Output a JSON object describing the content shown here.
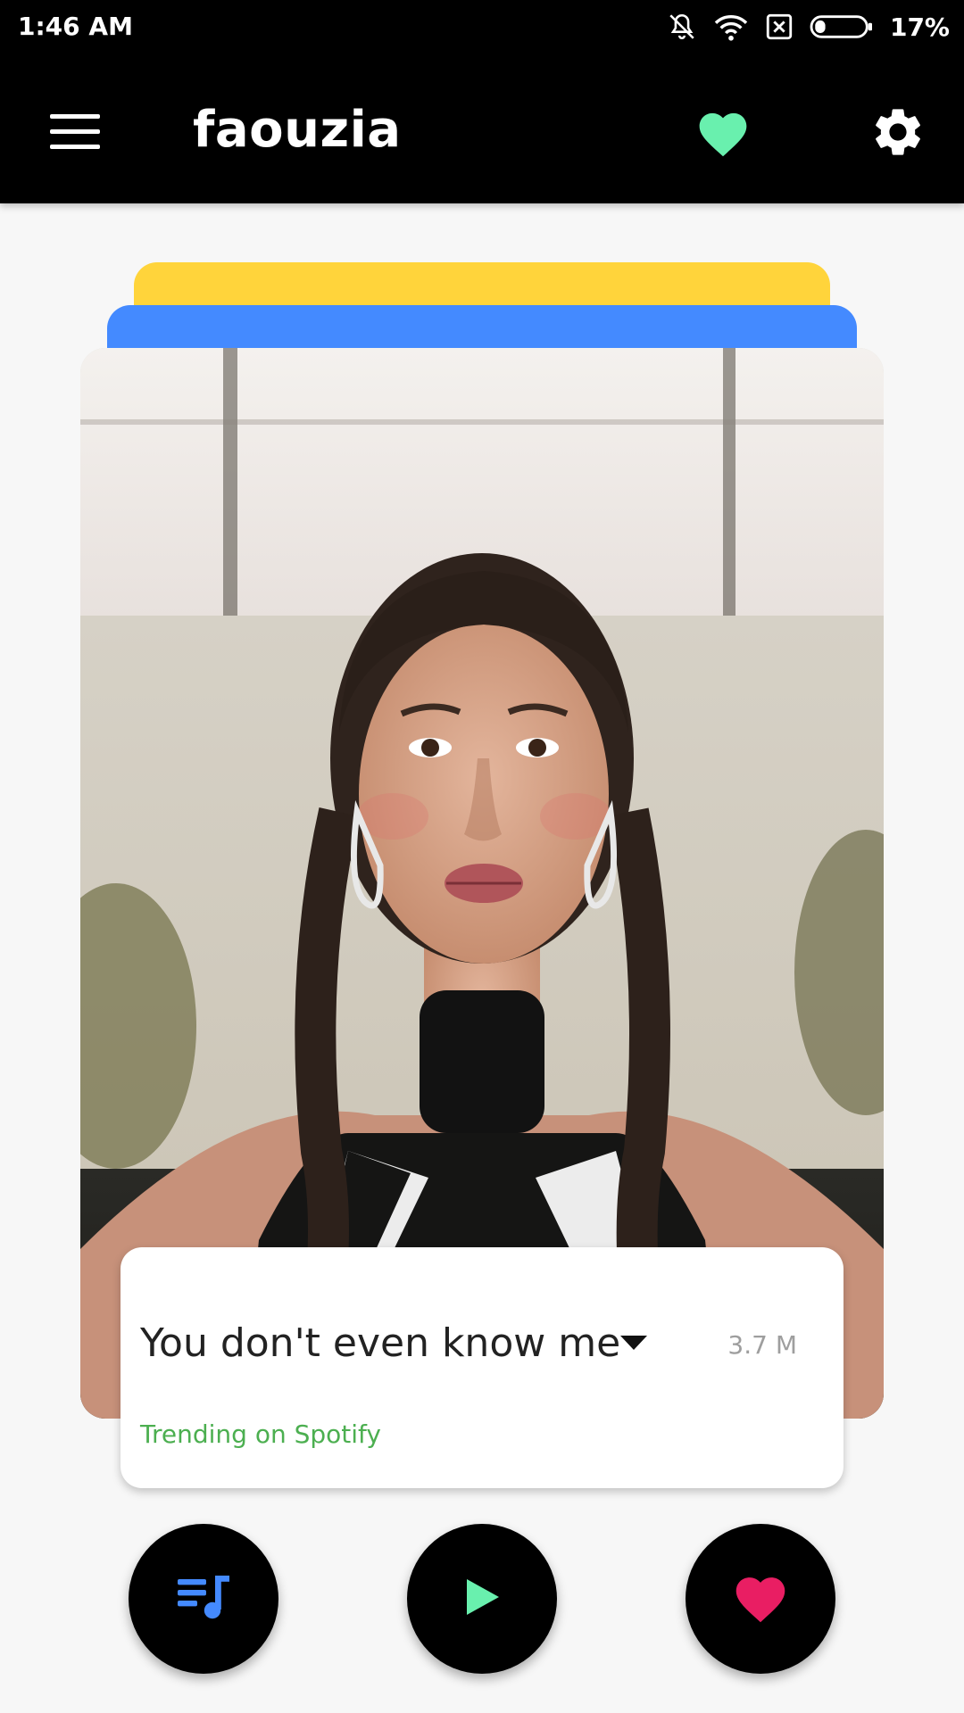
{
  "status_bar": {
    "time": "1:46 AM",
    "battery": "17%",
    "icons": [
      "notifications-off-icon",
      "wifi-icon",
      "no-sim-icon",
      "battery-icon"
    ]
  },
  "app_bar": {
    "title": "faouzia",
    "icons": [
      "menu-icon",
      "heart-icon",
      "gear-icon"
    ]
  },
  "card_stack": {
    "colors": [
      "#ffd43b",
      "#448aff"
    ]
  },
  "song": {
    "title": "You don't even know me",
    "streams": "3.7 M",
    "trend": "Trending on Spotify"
  },
  "actions": {
    "icons": [
      "queue-music-icon",
      "play-icon",
      "heart-icon"
    ]
  },
  "colors": {
    "app_bar": "#000000",
    "heart_accent": "#69f0ae",
    "like_accent": "#e91e63",
    "queue_accent": "#448aff",
    "play_accent": "#69f0ae",
    "trend_text": "#4caf50"
  }
}
